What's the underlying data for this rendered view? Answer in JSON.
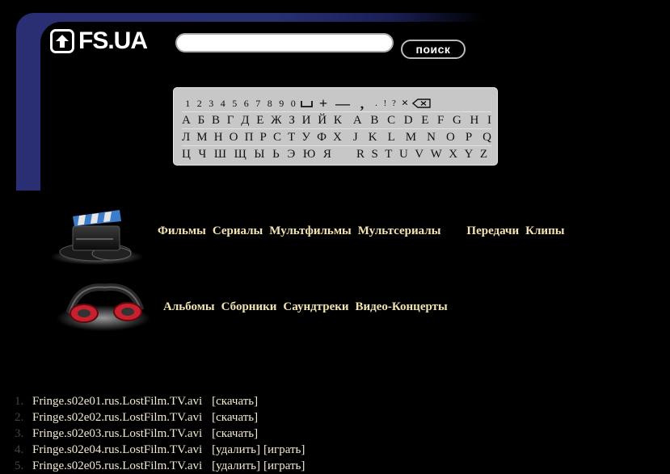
{
  "logo": {
    "text": "FS.UA"
  },
  "search": {
    "value": "",
    "button_label": "поиск"
  },
  "keyboard": {
    "digits": [
      "1",
      "2",
      "3",
      "4",
      "5",
      "6",
      "7",
      "8",
      "9",
      "0"
    ],
    "symbols": [
      "+",
      "—",
      ",",
      ".",
      "!",
      "?",
      "×"
    ],
    "rows": [
      {
        "cyr": [
          "А",
          "Б",
          "В",
          "Г",
          "Д",
          "Е",
          "Ж",
          "З",
          "И",
          "Й",
          "К"
        ],
        "lat": [
          "A",
          "B",
          "C",
          "D",
          "E",
          "F",
          "G",
          "H",
          "I"
        ]
      },
      {
        "cyr": [
          "Л",
          "М",
          "Н",
          "О",
          "П",
          "Р",
          "С",
          "Т",
          "У",
          "Ф",
          "Х"
        ],
        "lat": [
          "J",
          "K",
          "L",
          "M",
          "N",
          "O",
          "P",
          "Q"
        ]
      },
      {
        "cyr": [
          "Ц",
          "Ч",
          "Ш",
          "Щ",
          "Ы",
          "Ь",
          "Э",
          "Ю",
          "Я"
        ],
        "lat": [
          "R",
          "S",
          "T",
          "U",
          "V",
          "W",
          "X",
          "Y",
          "Z"
        ]
      }
    ]
  },
  "video_categories": [
    "Фильмы",
    "Сериалы",
    "Мультфильмы",
    "Мультсериалы",
    "Передачи",
    "Клипы"
  ],
  "audio_categories": [
    "Альбомы",
    "Сборники",
    "Саундтреки",
    "Видео-Концерты"
  ],
  "files": [
    {
      "num": "1.",
      "name": "Fringe.s02e01.rus.LostFilm.TV.avi",
      "actions": [
        "[скачать]"
      ]
    },
    {
      "num": "2.",
      "name": "Fringe.s02e02.rus.LostFilm.TV.avi",
      "actions": [
        "[скачать]"
      ]
    },
    {
      "num": "3.",
      "name": "Fringe.s02e03.rus.LostFilm.TV.avi",
      "actions": [
        "[скачать]"
      ]
    },
    {
      "num": "4.",
      "name": "Fringe.s02e04.rus.LostFilm.TV.avi",
      "actions": [
        "[удалить]",
        "[играть]"
      ]
    },
    {
      "num": "5.",
      "name": "Fringe.s02e05.rus.LostFilm.TV.avi",
      "actions": [
        "[удалить]",
        "[играть]"
      ]
    }
  ],
  "colors": {
    "link": "#f2e3b0",
    "header_blue": "#2a2e72",
    "background": "#000000"
  }
}
